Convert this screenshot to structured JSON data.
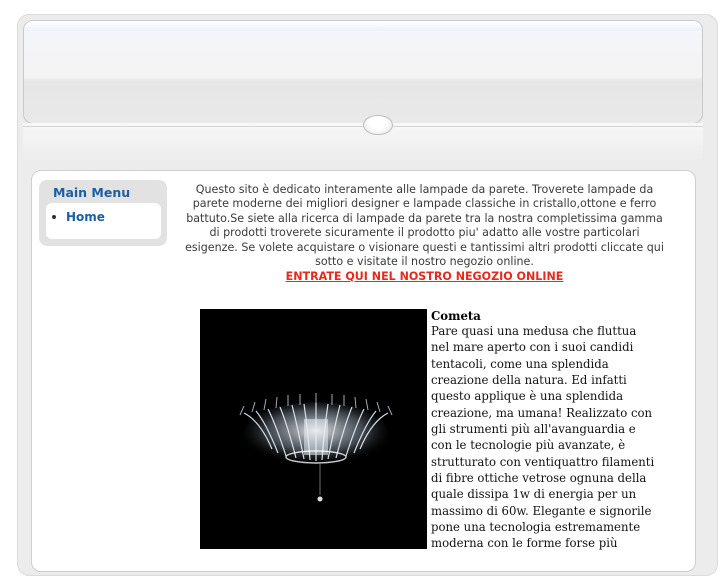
{
  "menu": {
    "title": "Main Menu",
    "items": [
      {
        "label": "Home"
      }
    ]
  },
  "intro": {
    "text": "Questo sito è dedicato interamente alle lampade da parete. Troverete lampade da parete moderne dei migliori designer e lampade classiche in cristallo,ottone e ferro battuto.Se siete alla ricerca di lampade da parete tra la nostra completissima gamma di prodotti troverete sicuramente il prodotto piu' adatto alle vostre particolari esigenze. Se volete acquistare o visionare questi e tantissimi altri prodotti cliccate qui sotto e visitate il nostro negozio online.",
    "shop_link": "ENTRATE QUI NEL NOSTRO NEGOZIO ONLINE",
    "link_color": "#e8291c"
  },
  "product": {
    "title": "Cometa",
    "description": "Pare quasi una medusa che fluttua nel mare aperto con i suoi candidi tentacoli, come una splendida creazione della natura. Ed infatti questo applique è una splendida creazione, ma umana! Realizzato con gli strumenti più all'avanguardia e con le tecnologie più avanzate, è strutturato con ventiquattro filamenti di fibre ottiche vetrose ognuna della quale dissipa 1w di energia per un massimo di 60w. Elegante e signorile pone una tecnologia estremamente moderna con le forme forse più"
  },
  "colors": {
    "menu_accent": "#1d5fa0",
    "panel_background": "#ececec"
  }
}
